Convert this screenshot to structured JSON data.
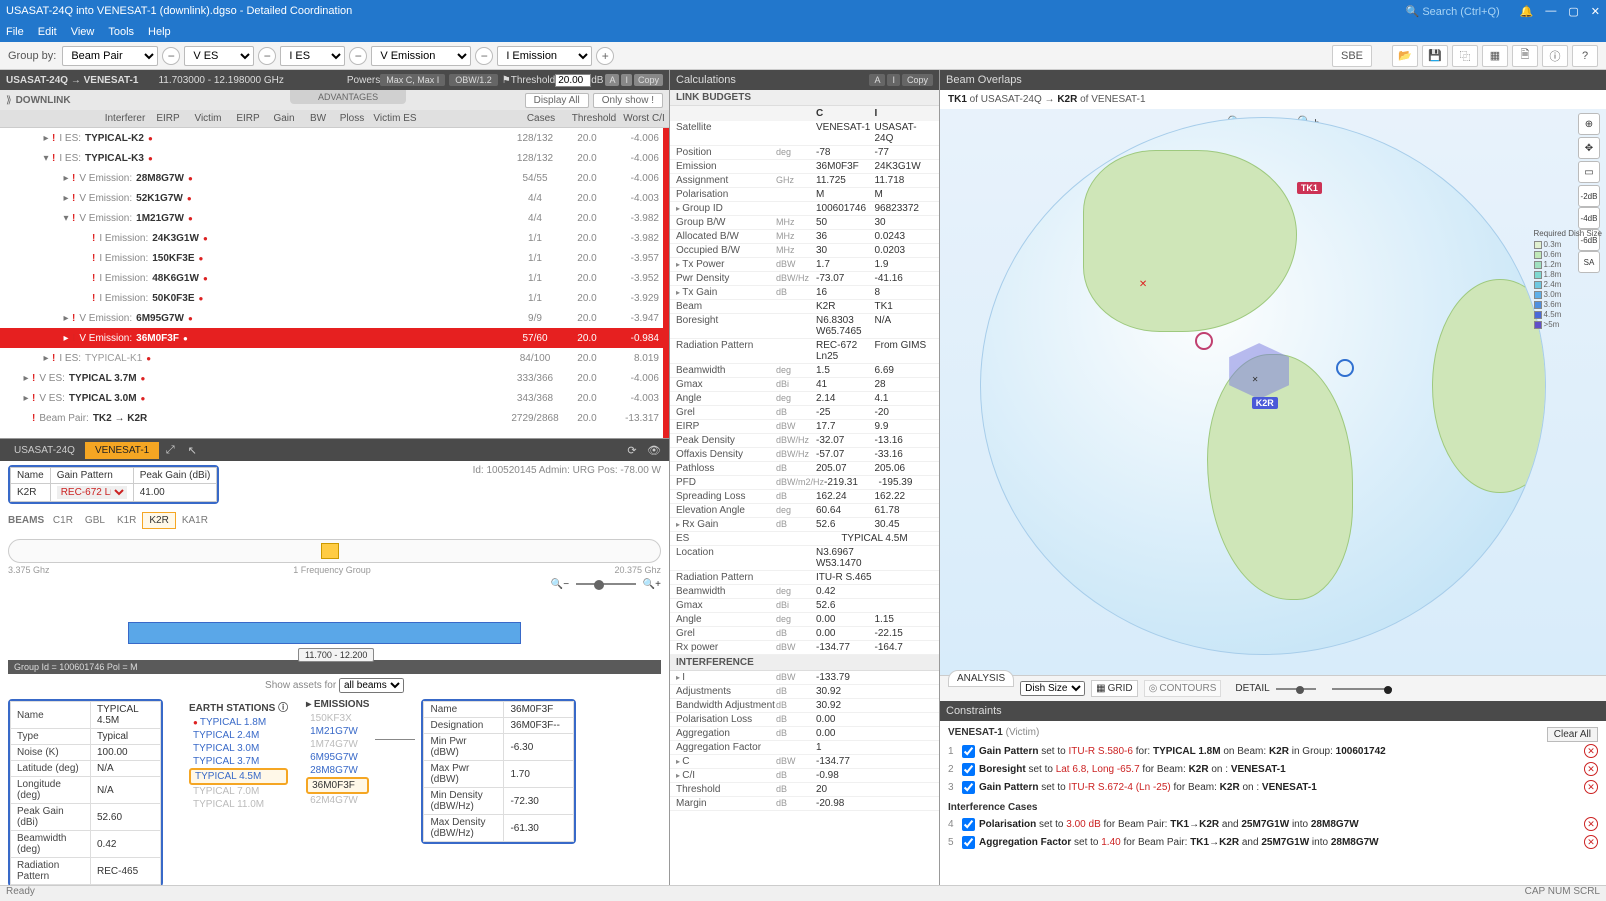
{
  "title": "USASAT-24Q into VENESAT-1 (downlink).dgso - Detailed Coordination",
  "search_placeholder": "Search (Ctrl+Q)",
  "menu": [
    "File",
    "Edit",
    "View",
    "Tools",
    "Help"
  ],
  "toolbar": {
    "groupby_label": "Group by:",
    "selects": [
      "Beam Pair",
      "V ES",
      "I ES",
      "V Emission",
      "I Emission"
    ],
    "sbe": "SBE"
  },
  "subheader": {
    "path": "USASAT-24Q → VENESAT-1",
    "freq": "11.703000 - 12.198000 GHz",
    "powers": "Powers",
    "maxc": "Max C, Max I",
    "obw": "OBW/1.2",
    "thresh_label": "Threshold",
    "thresh_val": "20.00",
    "db": "dB",
    "copy": "Copy",
    "a": "A",
    "i": "I"
  },
  "dlhdr": {
    "downlink": "DOWNLINK",
    "advantages": "ADVANTAGES",
    "display": "Display All",
    "onlyshow": "Only show !"
  },
  "cols": {
    "interferer": "Interferer",
    "eirp": "EIRP",
    "victim": "Victim",
    "eirp2": "EIRP",
    "gain": "Gain",
    "bw": "BW",
    "ploss": "Ploss",
    "victimes": "Victim ES",
    "cases": "Cases",
    "threshold": "Threshold",
    "worst": "Worst C/I"
  },
  "tree": [
    {
      "ind": 2,
      "exp": "▸",
      "cat": "I ES:",
      "nm": "TYPICAL-K2",
      "dot": true,
      "c1": "128/132",
      "c2": "20.0",
      "c3": "-4.006"
    },
    {
      "ind": 2,
      "exp": "▾",
      "cat": "I ES:",
      "nm": "TYPICAL-K3",
      "dot": true,
      "c1": "128/132",
      "c2": "20.0",
      "c3": "-4.006"
    },
    {
      "ind": 3,
      "exp": "▸",
      "cat": "V Emission:",
      "nm": "28M8G7W",
      "dot": true,
      "c1": "54/55",
      "c2": "20.0",
      "c3": "-4.006"
    },
    {
      "ind": 3,
      "exp": "▸",
      "cat": "V Emission:",
      "nm": "52K1G7W",
      "dot": true,
      "c1": "4/4",
      "c2": "20.0",
      "c3": "-4.003"
    },
    {
      "ind": 3,
      "exp": "▾",
      "cat": "V Emission:",
      "nm": "1M21G7W",
      "dot": true,
      "c1": "4/4",
      "c2": "20.0",
      "c3": "-3.982"
    },
    {
      "ind": 4,
      "exp": "",
      "cat": "I Emission:",
      "nm": "24K3G1W",
      "dot": true,
      "c1": "1/1",
      "c2": "20.0",
      "c3": "-3.982"
    },
    {
      "ind": 4,
      "exp": "",
      "cat": "I Emission:",
      "nm": "150KF3E",
      "dot": true,
      "c1": "1/1",
      "c2": "20.0",
      "c3": "-3.957"
    },
    {
      "ind": 4,
      "exp": "",
      "cat": "I Emission:",
      "nm": "48K6G1W",
      "dot": true,
      "c1": "1/1",
      "c2": "20.0",
      "c3": "-3.952"
    },
    {
      "ind": 4,
      "exp": "",
      "cat": "I Emission:",
      "nm": "50K0F3E",
      "dot": true,
      "c1": "1/1",
      "c2": "20.0",
      "c3": "-3.929"
    },
    {
      "ind": 3,
      "exp": "▸",
      "cat": "V Emission:",
      "nm": "6M95G7W",
      "dot": true,
      "c1": "9/9",
      "c2": "20.0",
      "c3": "-3.947"
    },
    {
      "ind": 3,
      "exp": "▸",
      "cat": "V Emission:",
      "nm": "36M0F3F",
      "dot": true,
      "sel": true,
      "c1": "57/60",
      "c2": "20.0",
      "c3": "-0.984"
    },
    {
      "ind": 2,
      "exp": "▸",
      "cat": "I ES:",
      "nm": "TYPICAL-K1",
      "dot": true,
      "dim": true,
      "c1": "84/100",
      "c2": "20.0",
      "c3": "8.019"
    },
    {
      "ind": 1,
      "exp": "▸",
      "cat": "V ES:",
      "nm": "TYPICAL 3.7M",
      "dot": true,
      "c1": "333/366",
      "c2": "20.0",
      "c3": "-4.006"
    },
    {
      "ind": 1,
      "exp": "▸",
      "cat": "V ES:",
      "nm": "TYPICAL 3.0M",
      "dot": true,
      "c1": "343/368",
      "c2": "20.0",
      "c3": "-4.003"
    },
    {
      "ind": 1,
      "exp": "",
      "cat": "Beam Pair:",
      "nm": "TK2 → K2R",
      "dot": false,
      "c1": "2729/2868",
      "c2": "20.0",
      "c3": "-13.317"
    }
  ],
  "bp": {
    "tabs": [
      "USASAT-24Q",
      "VENESAT-1"
    ],
    "name_lbl": "Name",
    "gp_lbl": "Gain Pattern",
    "pg_lbl": "Peak Gain (dBi)",
    "name_val": "K2R",
    "gp_val": "REC-672 Ln25",
    "pg_val": "41.00",
    "info": "Id: 100520145   Admin: URG   Pos:  -78.00 W",
    "beams_lbl": "BEAMS",
    "beams": [
      "C1R",
      "GBL",
      "K1R",
      "K2R",
      "KA1R"
    ],
    "freq_lo": "3.375 Ghz",
    "freq_hi": "20.375 Ghz",
    "freq_grp": "1 Frequency Group",
    "range": "11.700 - 12.200",
    "showassets": "Show assets for",
    "allbeams": "all beams",
    "groupid": "Group Id = 100601746  Pol = M",
    "props": [
      [
        "Name",
        "TYPICAL 4.5M"
      ],
      [
        "Type",
        "Typical"
      ],
      [
        "Noise (K)",
        "100.00"
      ],
      [
        "Latitude (deg)",
        "N/A"
      ],
      [
        "Longitude (deg)",
        "N/A"
      ],
      [
        "Peak Gain (dBi)",
        "52.60"
      ],
      [
        "Beamwidth (deg)",
        "0.42"
      ],
      [
        "Radiation Pattern",
        "REC-465"
      ]
    ],
    "es_hdr": "EARTH STATIONS",
    "es": [
      {
        "n": "TYPICAL 1.8M",
        "d": true
      },
      {
        "n": "TYPICAL 2.4M"
      },
      {
        "n": "TYPICAL 3.0M"
      },
      {
        "n": "TYPICAL 3.7M"
      },
      {
        "n": "TYPICAL 4.5M",
        "sel": true
      },
      {
        "n": "TYPICAL 7.0M",
        "dim": true
      },
      {
        "n": "TYPICAL 11.0M",
        "dim": true
      }
    ],
    "em_hdr": "EMISSIONS",
    "em": [
      {
        "n": "150KF3X",
        "dim": true
      },
      {
        "n": "1M21G7W"
      },
      {
        "n": "1M74G7W",
        "dim": true
      },
      {
        "n": "6M95G7W"
      },
      {
        "n": "28M8G7W"
      },
      {
        "n": "36M0F3F",
        "sel": true
      },
      {
        "n": "62M4G7W",
        "dim": true
      }
    ],
    "em_props_hdr": [
      "Name",
      "36M0F3F"
    ],
    "em_props": [
      [
        "Designation",
        "36M0F3F--"
      ],
      [
        "Min Pwr (dBW)",
        "-6.30"
      ],
      [
        "Max Pwr (dBW)",
        "1.70"
      ],
      [
        "Min Density (dBW/Hz)",
        "-72.30"
      ],
      [
        "Max Density (dBW/Hz)",
        "-61.30"
      ]
    ]
  },
  "calc": {
    "title": "Calculations",
    "link_budgets": "LINK BUDGETS",
    "c": "C",
    "i": "I",
    "rows": [
      [
        "Satellite",
        "",
        "VENESAT-1",
        "USASAT-24Q"
      ],
      [
        "Position",
        "deg",
        "-78",
        "-77"
      ],
      [
        "Emission",
        "",
        "36M0F3F",
        "24K3G1W"
      ],
      [
        "Assignment",
        "GHz",
        "11.725",
        "11.718"
      ],
      [
        "Polarisation",
        "",
        "M",
        "M"
      ],
      [
        "Group ID",
        "",
        "100601746",
        "96823372",
        true
      ],
      [
        "Group B/W",
        "MHz",
        "50",
        "30"
      ],
      [
        "Allocated B/W",
        "MHz",
        "36",
        "0.0243"
      ],
      [
        "Occupied B/W",
        "MHz",
        "30",
        "0.0203"
      ],
      [
        "Tx Power",
        "dBW",
        "1.7",
        "1.9",
        true
      ],
      [
        "Pwr Density",
        "dBW/Hz",
        "-73.07",
        "-41.16"
      ],
      [
        "Tx Gain",
        "dB",
        "16",
        "8",
        true
      ],
      [
        "Beam",
        "",
        "K2R",
        "TK1"
      ],
      [
        "Boresight",
        "",
        "N6.8303 W65.7465",
        "N/A"
      ],
      [
        "Radiation Pattern",
        "",
        "REC-672 Ln25",
        "From GIMS"
      ],
      [
        "Beamwidth",
        "deg",
        "1.5",
        "6.69"
      ],
      [
        "Gmax",
        "dBi",
        "41",
        "28"
      ],
      [
        "Angle",
        "deg",
        "2.14",
        "4.1"
      ],
      [
        "Grel",
        "dB",
        "-25",
        "-20"
      ],
      [
        "EIRP",
        "dBW",
        "17.7",
        "9.9"
      ],
      [
        "Peak Density",
        "dBW/Hz",
        "-32.07",
        "-13.16"
      ],
      [
        "Offaxis Density",
        "dBW/Hz",
        "-57.07",
        "-33.16"
      ],
      [
        "Pathloss",
        "dB",
        "205.07",
        "205.06"
      ],
      [
        "PFD",
        "dBW/m2/Hz",
        "-219.31",
        "-195.39"
      ],
      [
        "Spreading Loss",
        "dB",
        "162.24",
        "162.22"
      ],
      [
        "Elevation Angle",
        "deg",
        "60.64",
        "61.78"
      ],
      [
        "Rx Gain",
        "dB",
        "52.6",
        "30.45",
        true
      ]
    ],
    "es_row": [
      "ES",
      "",
      "TYPICAL 4.5M"
    ],
    "rows2": [
      [
        "Location",
        "",
        "N3.6967 W53.1470",
        ""
      ],
      [
        "Radiation Pattern",
        "",
        "ITU-R S.465",
        ""
      ],
      [
        "Beamwidth",
        "deg",
        "0.42",
        ""
      ],
      [
        "Gmax",
        "dBi",
        "52.6",
        ""
      ],
      [
        "Angle",
        "deg",
        "0.00",
        "1.15"
      ],
      [
        "Grel",
        "dB",
        "0.00",
        "-22.15"
      ],
      [
        "Rx power",
        "dBW",
        "-134.77",
        "-164.7"
      ]
    ],
    "interf": "INTERFERENCE",
    "irows": [
      [
        "I",
        "dBW",
        "-133.79",
        "",
        true
      ],
      [
        "Adjustments",
        "dB",
        "30.92",
        ""
      ],
      [
        "Bandwidth Adjustment",
        "dB",
        "30.92",
        ""
      ],
      [
        "Polarisation Loss",
        "dB",
        "0.00",
        ""
      ],
      [
        "Aggregation",
        "dB",
        "0.00",
        ""
      ],
      [
        "Aggregation Factor",
        "",
        "1",
        ""
      ],
      [
        "C",
        "dBW",
        "-134.77",
        "",
        true
      ],
      [
        "C/I",
        "dB",
        "-0.98",
        "",
        true
      ],
      [
        "Threshold",
        "dB",
        "20",
        ""
      ],
      [
        "Margin",
        "dB",
        "-20.98",
        ""
      ]
    ]
  },
  "overlap": {
    "title": "Beam Overlaps",
    "sub_tk1": "TK1",
    "sub_of1": " of USASAT-24Q  →  ",
    "sub_k2r": "K2R",
    "sub_of2": " of VENESAT-1",
    "tk1_lbl": "TK1",
    "k2r_lbl": "K2R",
    "legend_title": "Required Dish Size",
    "legend": [
      "0.3m",
      "0.6m",
      "1.2m",
      "1.8m",
      "2.4m",
      "3.0m",
      "3.6m",
      "4.5m",
      ">5m"
    ],
    "side": [
      "-2dB",
      "-4dB",
      "-6dB",
      "SA"
    ]
  },
  "analysis": {
    "label": "ANALYSIS",
    "dish": "Dish Size",
    "grid": "GRID",
    "contours": "CONTOURS",
    "detail": "DETAIL"
  },
  "constraints": {
    "title": "Constraints",
    "clear": "Clear All",
    "victim": "VENESAT-1",
    "victim_sub": "(Victim)",
    "rows": [
      {
        "n": "1",
        "lbl": "Gain Pattern",
        "txt": " set to ",
        "r": "ITU-R S.580-6",
        "t2": " for: ",
        "b": "TYPICAL 1.8M",
        "t3": " on Beam: ",
        "b2": "K2R",
        "t4": " in Group: ",
        "b3": "100601742"
      },
      {
        "n": "2",
        "lbl": "Boresight",
        "txt": " set to ",
        "r": "Lat 6.8, Long -65.7",
        "t2": " for Beam: ",
        "b": "K2R",
        "t3": " on : ",
        "b2": "VENESAT-1"
      },
      {
        "n": "3",
        "lbl": "Gain Pattern",
        "txt": " set to ",
        "r": "ITU-R S.672-4 (Ln -25)",
        "t2": " for Beam: ",
        "b": "K2R",
        "t3": " on : ",
        "b2": "VENESAT-1"
      }
    ],
    "cases_hdr": "Interference Cases",
    "cases": [
      {
        "n": "4",
        "lbl": "Polarisation",
        "txt": " set to ",
        "r": "3.00 dB",
        "t2": " for Beam Pair: ",
        "b": "TK1→K2R",
        "t3": " and ",
        "b2": "25M7G1W",
        "t4": " into ",
        "b3": "28M8G7W"
      },
      {
        "n": "5",
        "lbl": "Aggregation Factor",
        "txt": " set to ",
        "r": "1.40",
        "t2": " for Beam Pair: ",
        "b": "TK1→K2R",
        "t3": " and ",
        "b2": "25M7G1W",
        "t4": " into ",
        "b3": "28M8G7W"
      }
    ]
  },
  "status": {
    "ready": "Ready",
    "caps": "CAP  NUM  SCRL"
  }
}
